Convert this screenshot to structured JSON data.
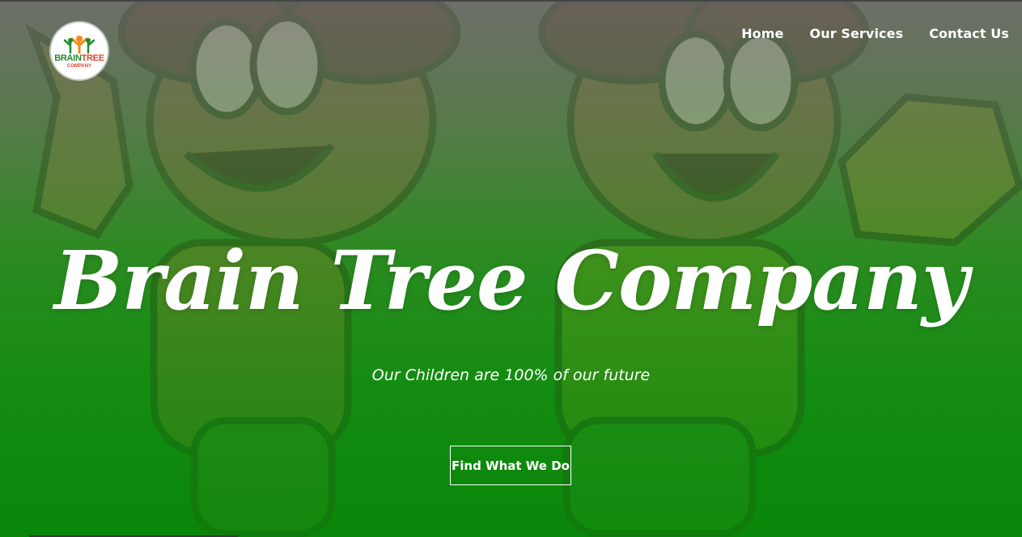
{
  "logo": {
    "brand_word1": "BRAIN",
    "brand_word2": "TREE",
    "brand_sub": "COMPANY"
  },
  "nav": {
    "items": [
      "Home",
      "Our Services",
      "Contact Us"
    ]
  },
  "hero": {
    "title": "Brain Tree Company",
    "subtitle": "Our Children are 100% of our future",
    "cta_label": "Find What We Do",
    "background_image": "cartoon-kids"
  },
  "colors": {
    "accent_green": "#0a850a",
    "text": "#ffffff",
    "logo_green": "#1e8a2c",
    "logo_red": "#e0402a",
    "logo_orange": "#f08a1c"
  }
}
